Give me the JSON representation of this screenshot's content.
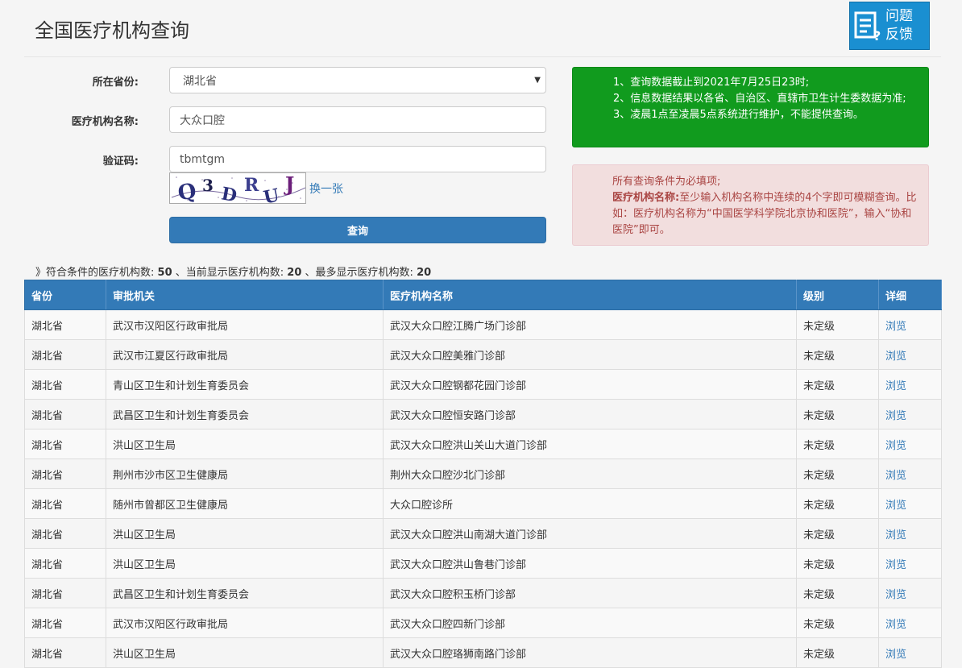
{
  "header": {
    "title": "全国医疗机构查询",
    "feedback_line1": "问题",
    "feedback_line2": "反馈"
  },
  "form": {
    "province_label": "所在省份:",
    "province_value": "湖北省",
    "name_label": "医疗机构名称:",
    "name_value": "大众口腔",
    "captcha_label": "验证码:",
    "captcha_value": "tbmtgm",
    "captcha_image_text": "Q3DRUJ",
    "refresh_label": "换一张",
    "submit_label": "查询"
  },
  "notices": {
    "info_lines": [
      "1、查询数据截止到2021年7月25日23时;",
      "2、信息数据结果以各省、自治区、直辖市卫生计生委数据为准;",
      "3、凌晨1点至凌晨5点系统进行维护，不能提供查询。"
    ],
    "warn_line1": "所有查询条件为必填项;",
    "warn_bold": "医疗机构名称:",
    "warn_rest": "至少输入机构名称中连续的4个字即可模糊查询。比如：医疗机构名称为“中国医学科学院北京协和医院”，输入“协和医院”即可。"
  },
  "summary": {
    "prefix": "》符合条件的医疗机构数:",
    "total": "50",
    "sep1": "、当前显示医疗机构数:",
    "shown": "20",
    "sep2": "、最多显示医疗机构数:",
    "max": "20"
  },
  "table": {
    "headers": [
      "省份",
      "审批机关",
      "医疗机构名称",
      "级别",
      "详细"
    ],
    "rows": [
      [
        "湖北省",
        "武汉市汉阳区行政审批局",
        "武汉大众口腔江腾广场门诊部",
        "未定级",
        "浏览"
      ],
      [
        "湖北省",
        "武汉市江夏区行政审批局",
        "武汉大众口腔美雅门诊部",
        "未定级",
        "浏览"
      ],
      [
        "湖北省",
        "青山区卫生和计划生育委员会",
        "武汉大众口腔钢都花园门诊部",
        "未定级",
        "浏览"
      ],
      [
        "湖北省",
        "武昌区卫生和计划生育委员会",
        "武汉大众口腔恒安路门诊部",
        "未定级",
        "浏览"
      ],
      [
        "湖北省",
        "洪山区卫生局",
        "武汉大众口腔洪山关山大道门诊部",
        "未定级",
        "浏览"
      ],
      [
        "湖北省",
        "荆州市沙市区卫生健康局",
        "荆州大众口腔沙北门诊部",
        "未定级",
        "浏览"
      ],
      [
        "湖北省",
        "随州市曾都区卫生健康局",
        "大众口腔诊所",
        "未定级",
        "浏览"
      ],
      [
        "湖北省",
        "洪山区卫生局",
        "武汉大众口腔洪山南湖大道门诊部",
        "未定级",
        "浏览"
      ],
      [
        "湖北省",
        "洪山区卫生局",
        "武汉大众口腔洪山鲁巷门诊部",
        "未定级",
        "浏览"
      ],
      [
        "湖北省",
        "武昌区卫生和计划生育委员会",
        "武汉大众口腔积玉桥门诊部",
        "未定级",
        "浏览"
      ],
      [
        "湖北省",
        "武汉市汉阳区行政审批局",
        "武汉大众口腔四新门诊部",
        "未定级",
        "浏览"
      ],
      [
        "湖北省",
        "洪山区卫生局",
        "武汉大众口腔珞狮南路门诊部",
        "未定级",
        "浏览"
      ]
    ]
  },
  "colors": {
    "primary": "#337ab7",
    "success": "#119b1e",
    "danger_bg": "#f2dede",
    "danger_text": "#a94442"
  }
}
